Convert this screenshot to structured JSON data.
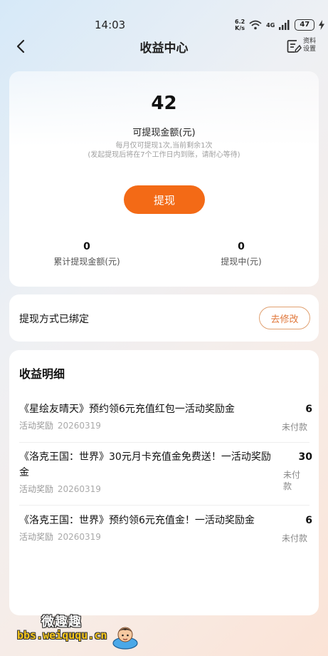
{
  "status_bar": {
    "time": "14:03",
    "net_speed_value": "6.2",
    "net_speed_unit": "K/s",
    "network_label": "4G",
    "battery": "47"
  },
  "nav": {
    "title": "收益中心",
    "profile_label": "资料设置"
  },
  "balance": {
    "amount": "42",
    "label": "可提现金额(元)",
    "limit_line1": "每月仅可提现1次,当前剩余1次",
    "limit_line2": "(发起提现后将在7个工作日内到账，请耐心等待)",
    "withdraw_button": "提现",
    "stats": [
      {
        "value": "0",
        "label": "累计提现金额(元)"
      },
      {
        "value": "0",
        "label": "提现中(元)"
      }
    ]
  },
  "withdraw_method": {
    "text": "提现方式已绑定",
    "modify_button": "去修改"
  },
  "details": {
    "title": "收益明细",
    "items": [
      {
        "name": "《星绘友晴天》预约领6元充值红包一活动奖励金",
        "tag": "活动奖励",
        "date": "20260319",
        "amount": "6",
        "status": "未付款"
      },
      {
        "name": "《洛克王国：世界》30元月卡充值金免费送！一活动奖励金",
        "tag": "活动奖励",
        "date": "20260319",
        "amount": "30",
        "status": "未付款"
      },
      {
        "name": "《洛克王国：世界》预约领6元充值金！一活动奖励金",
        "tag": "活动奖励",
        "date": "20260319",
        "amount": "6",
        "status": "未付款"
      }
    ]
  },
  "watermark": {
    "title": "微趣趣",
    "url": "bbs.weiququ.cn"
  },
  "colors": {
    "accent": "#f36a16",
    "modify_border": "#e0a070",
    "modify_text": "#e0773a"
  }
}
